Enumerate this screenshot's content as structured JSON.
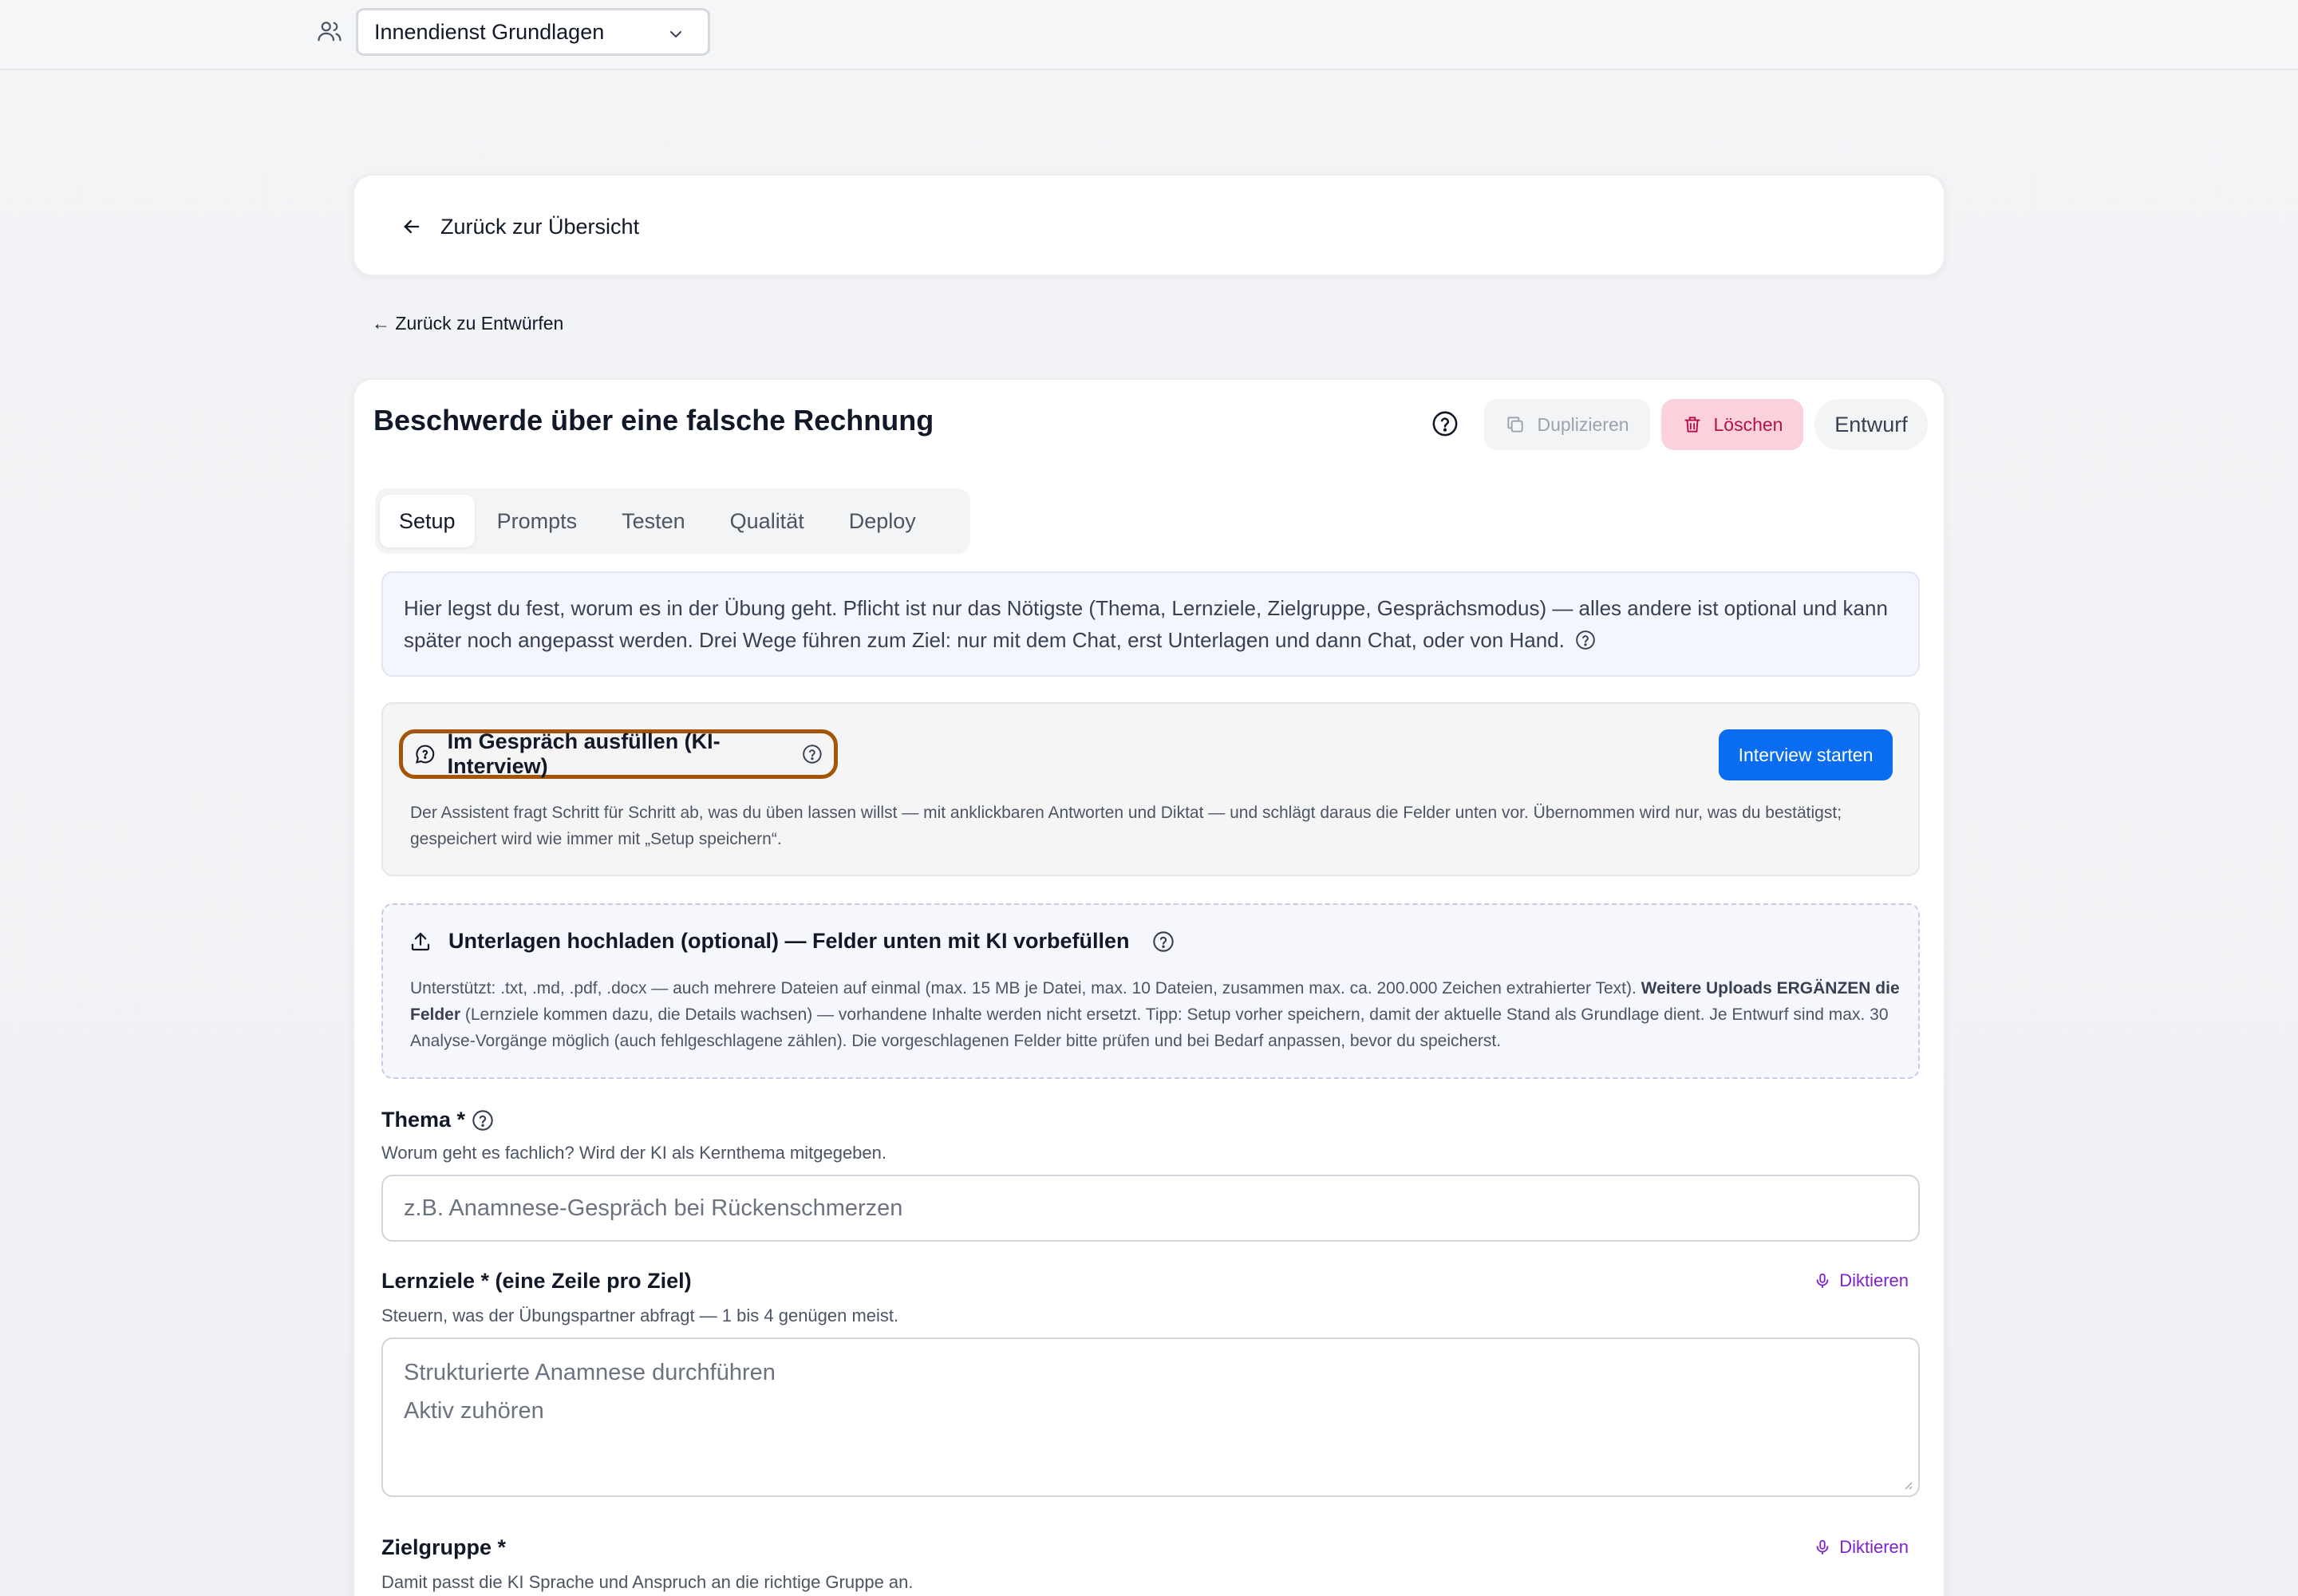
{
  "topbar": {
    "team_select_value": "Innendienst Grundlagen"
  },
  "back_card": {
    "back_label": "Zurück zur Übersicht"
  },
  "drafts_link": "← Zurück zu Entwürfen",
  "header": {
    "title": "Beschwerde über eine falsche Rechnung",
    "duplicate_label": "Duplizieren",
    "delete_label": "Löschen",
    "status_badge": "Entwurf"
  },
  "tabs": [
    {
      "label": "Setup",
      "active": true
    },
    {
      "label": "Prompts",
      "active": false
    },
    {
      "label": "Testen",
      "active": false
    },
    {
      "label": "Qualität",
      "active": false
    },
    {
      "label": "Deploy",
      "active": false
    }
  ],
  "intro": {
    "text": "Hier legst du fest, worum es in der Übung geht. Pflicht ist nur das Nötigste (Thema, Lernziele, Zielgruppe, Gesprächsmodus) — alles andere ist optional und kann später noch angepasst werden. Drei Wege führen zum Ziel: nur mit dem Chat, erst Unterlagen und dann Chat, oder von Hand."
  },
  "interview": {
    "title": "Im Gespräch ausfüllen (KI-Interview)",
    "start_label": "Interview starten",
    "description": "Der Assistent fragt Schritt für Schritt ab, was du üben lassen willst — mit anklickbaren Antworten und Diktat — und schlägt daraus die Felder unten vor. Übernommen wird nur, was du bestätigst; gespeichert wird wie immer mit „Setup speichern“."
  },
  "upload": {
    "title": "Unterlagen hochladen (optional) — Felder unten mit KI vorbefüllen",
    "desc_part1": "Unterstützt: .txt, .md, .pdf, .docx — auch mehrere Dateien auf einmal (max. 15 MB je Datei, max. 10 Dateien, zusammen max. ca. 200.000 Zeichen extrahierter Text). ",
    "desc_bold": "Weitere Uploads ERGÄNZEN die Felder",
    "desc_part2": " (Lernziele kommen dazu, die Details wachsen) — vorhandene Inhalte werden nicht ersetzt. Tipp: Setup vorher speichern, damit der aktuelle Stand als Grundlage dient. Je Entwurf sind max. 30 Analyse-Vorgänge möglich (auch fehlgeschlagene zählen). Die vorgeschlagenen Felder bitte prüfen und bei Bedarf anpassen, bevor du speicherst."
  },
  "fields": {
    "thema": {
      "label": "Thema *",
      "hint": "Worum geht es fachlich? Wird der KI als Kernthema mitgegeben.",
      "placeholder": "z.B. Anamnese-Gespräch bei Rückenschmerzen"
    },
    "lernziele": {
      "label": "Lernziele * (eine Zeile pro Ziel)",
      "hint": "Steuern, was der Übungspartner abfragt — 1 bis 4 genügen meist.",
      "placeholder_line1": "Strukturierte Anamnese durchführen",
      "placeholder_line2": "Aktiv zuhören",
      "dictate_label": "Diktieren"
    },
    "zielgruppe": {
      "label": "Zielgruppe *",
      "hint": "Damit passt die KI Sprache und Anspruch an die richtige Gruppe an.",
      "dictate_label": "Diktieren"
    }
  },
  "icons": {
    "team": "users-icon",
    "chevron": "chevron-down-icon",
    "back": "arrow-left-icon",
    "help": "help-circle-icon",
    "duplicate": "copy-icon",
    "delete": "trash-icon",
    "chat": "chat-bubble-icon",
    "upload": "upload-icon",
    "mic": "mic-icon"
  },
  "colors": {
    "primary": "#0a6cf0",
    "delete_bg": "#fbd1dc",
    "delete_fg": "#b0124a",
    "highlight_outline": "#a55507",
    "dictate": "#7e22ce"
  }
}
